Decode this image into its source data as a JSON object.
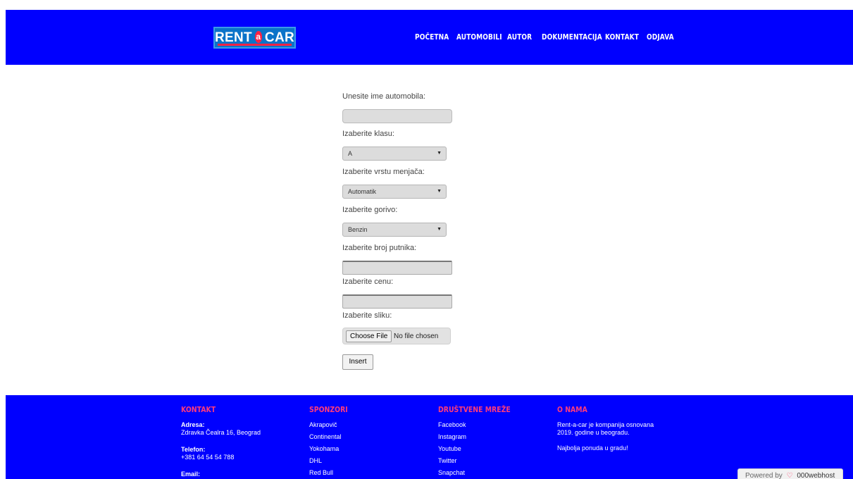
{
  "header": {
    "logo": {
      "left": "RENT",
      "mid": "a",
      "right": "CAR"
    },
    "nav": [
      {
        "name": "nav-pocetna",
        "label": "POČETNA"
      },
      {
        "name": "nav-automobili",
        "label": "AUTOMOBILI"
      },
      {
        "name": "nav-autor",
        "label": "AUTOR"
      },
      {
        "name": "nav-dokumentacija",
        "label": "DOKUMENTACIJA"
      },
      {
        "name": "nav-kontakt",
        "label": "KONTAKT"
      },
      {
        "name": "nav-odjava",
        "label": "ODJAVA"
      }
    ]
  },
  "form": {
    "car_name_label": "Unesite ime automobila:",
    "car_name_value": "",
    "class_label": "Izaberite klasu:",
    "class_value": "A",
    "gearbox_label": "Izaberite vrstu menjača:",
    "gearbox_value": "Automatik",
    "fuel_label": "Izaberite gorivo:",
    "fuel_value": "Benzin",
    "passengers_label": "Izaberite broj putnika:",
    "price_label": "Izaberite cenu:",
    "image_label": "Izaberite sliku:",
    "file_button": "Choose File",
    "file_status": "No file chosen",
    "submit": "Insert"
  },
  "footer": {
    "kontakt": {
      "title": "KONTAKT",
      "address_label": "Adresa:",
      "address_value": "Zdravka Čealra 16, Beograd",
      "phone_label": "Telefon:",
      "phone_value": "+381 64 54 54 788",
      "email_label": "Email:"
    },
    "sponzori": {
      "title": "SPONZORI",
      "items": [
        "Akrapovič",
        "Continental",
        "Yokohama",
        "DHL",
        "Red Bull"
      ]
    },
    "mreze": {
      "title": "DRUŠTVENE MREŽE",
      "items": [
        "Facebook",
        "Instagram",
        "Youtube",
        "Twitter",
        "Snapchat"
      ]
    },
    "o_nama": {
      "title": "O NAMA",
      "line1": "Rent-a-car je kompanija osnovana",
      "line2": "2019. godine u beogradu.",
      "line3": "Najbolja ponuda u gradu!"
    }
  },
  "badge": {
    "prefix": "Powered by",
    "brand": "000webhost"
  },
  "colors": {
    "header_bg": "#0000ff",
    "footer_heading": "#ff3b7b",
    "logo_bg": "#0a73c9"
  }
}
